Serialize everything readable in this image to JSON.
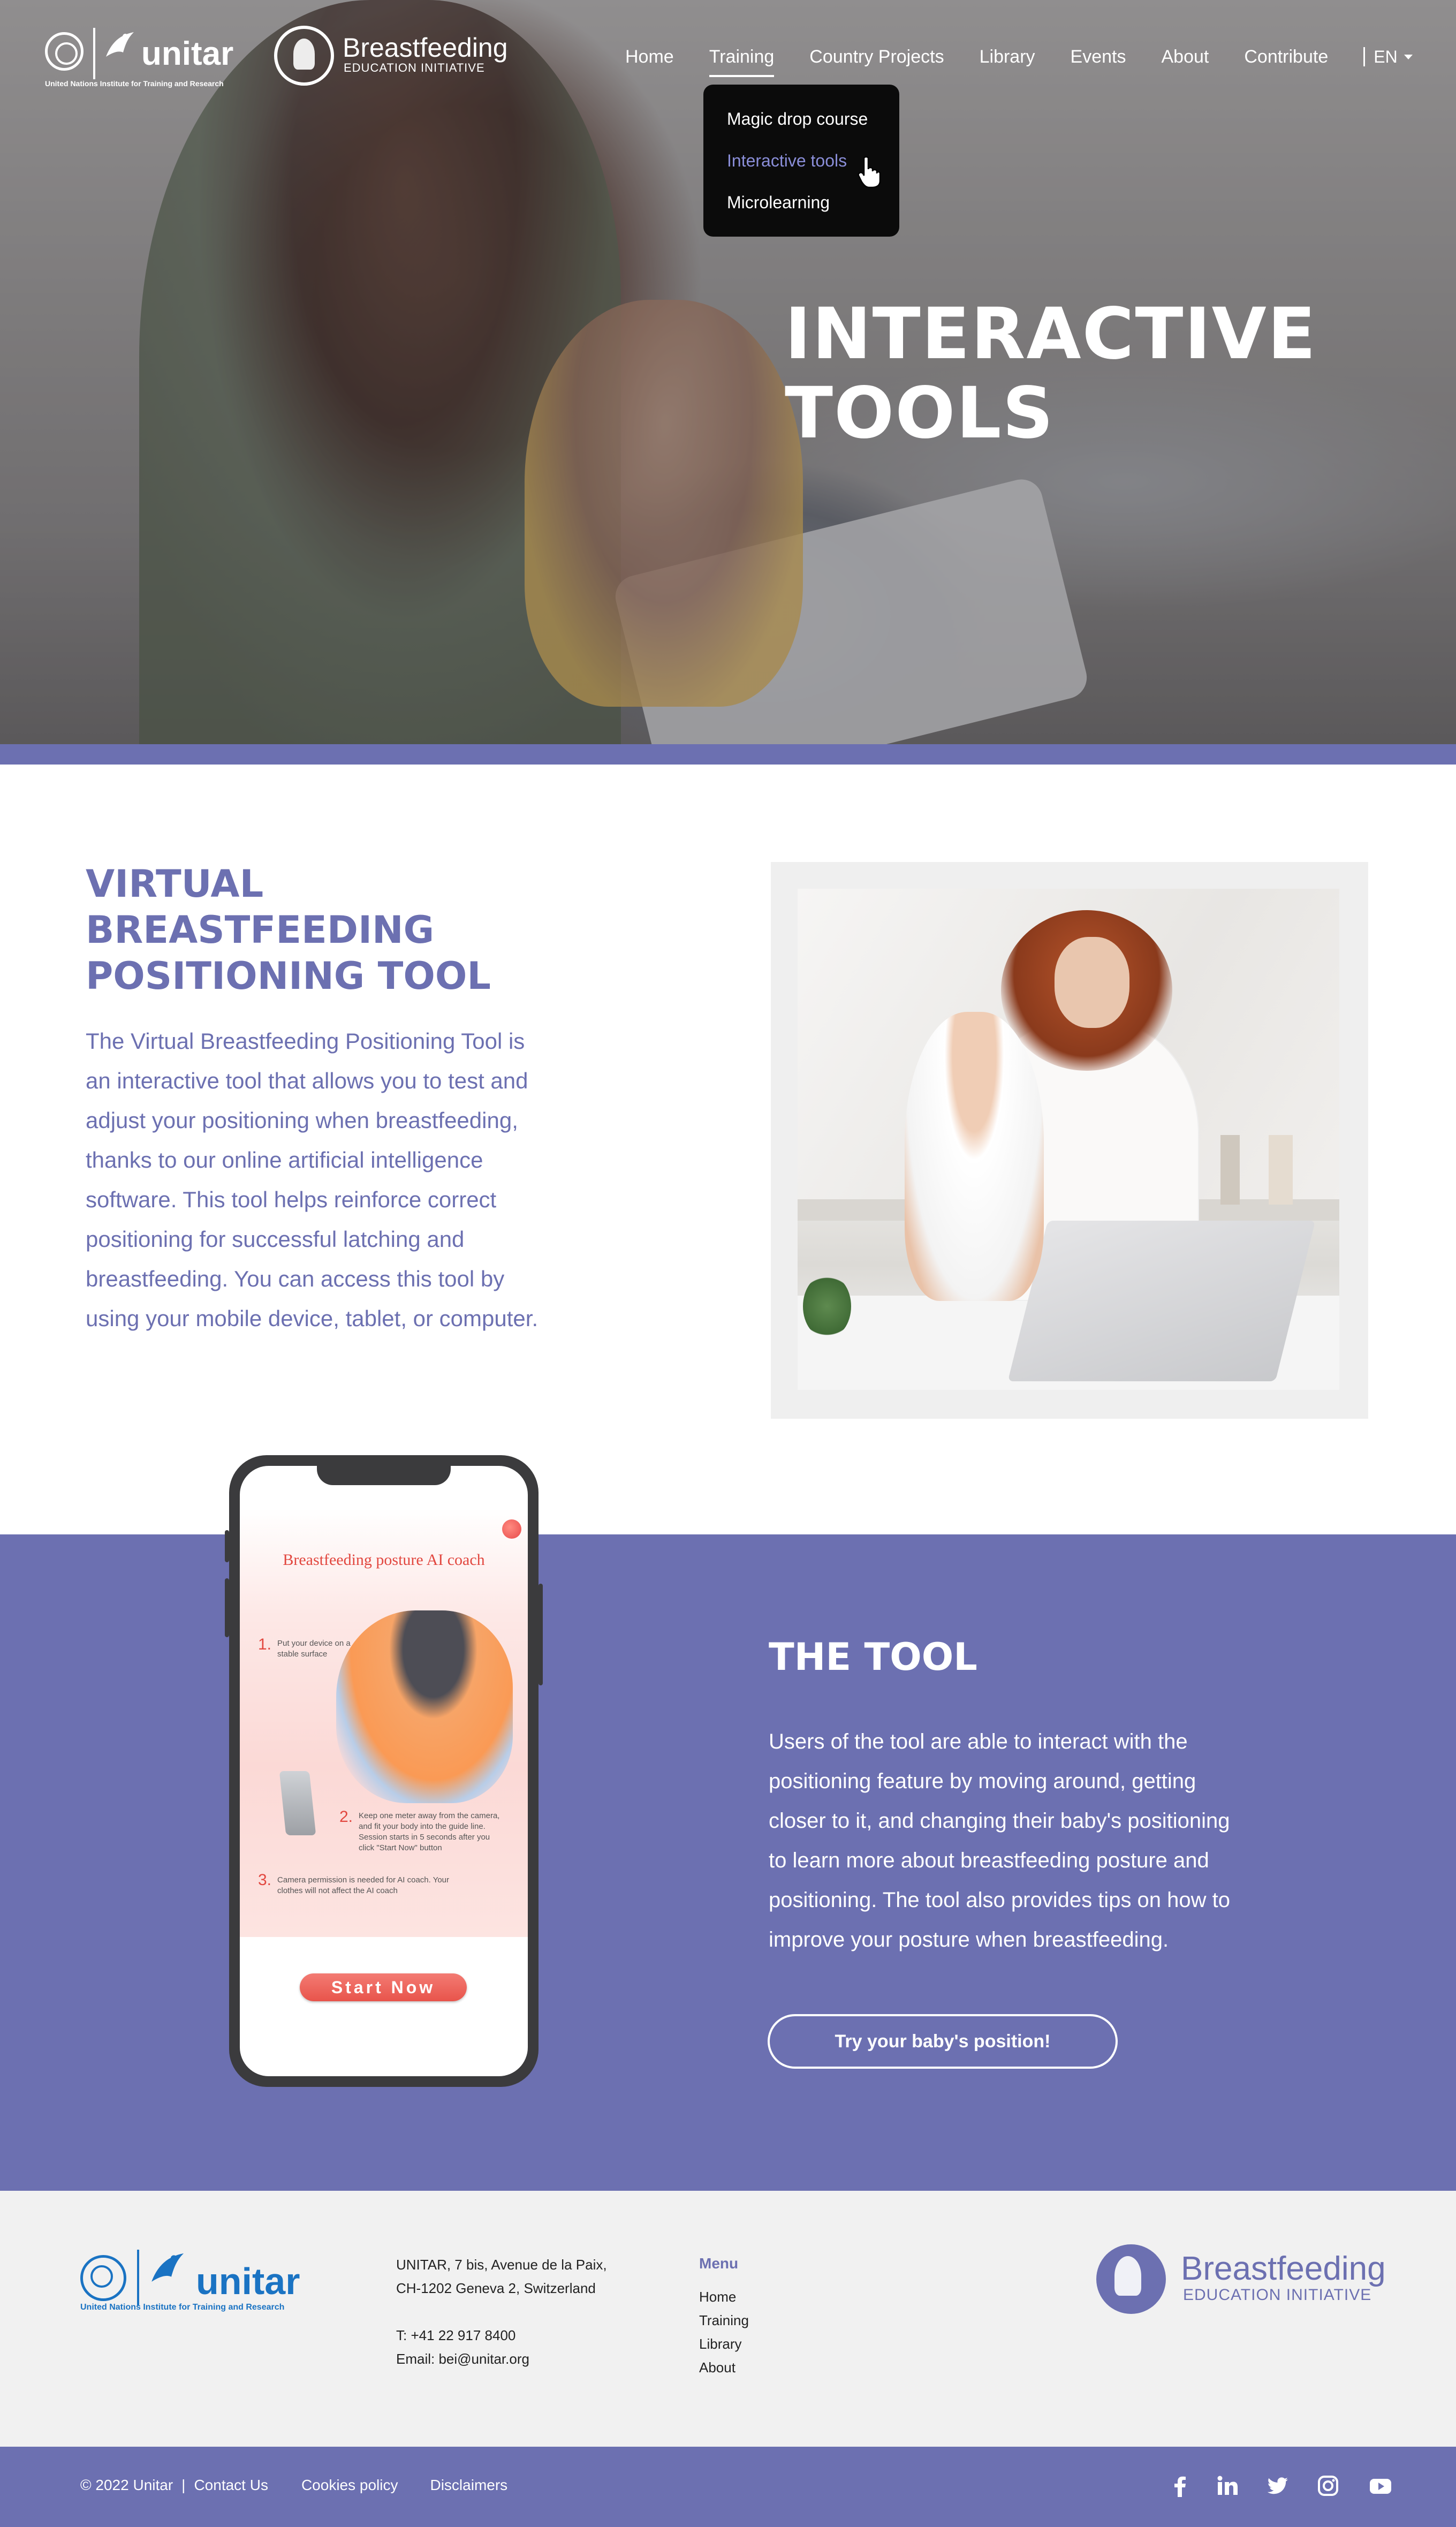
{
  "hero": {
    "title_line1": "INTERACTIVE",
    "title_line2": "TOOLS"
  },
  "logos": {
    "unitar_word": "unitar",
    "unitar_subtitle": "United Nations Institute for Training and Research",
    "bei_name": "Breastfeeding",
    "bei_tagline": "EDUCATION INITIATIVE"
  },
  "nav": {
    "items": [
      "Home",
      "Training",
      "Country Projects",
      "Library",
      "Events",
      "About",
      "Contribute"
    ],
    "active": "Training",
    "language": "EN"
  },
  "dropdown": {
    "items": [
      "Magic drop course",
      "Interactive tools",
      "Microlearning"
    ],
    "selected": "Interactive tools"
  },
  "section_vbpt": {
    "title_line1": "VIRTUAL",
    "title_line2": "BREASTFEEDING",
    "title_line3": "POSITIONING TOOL",
    "lines": [
      "The Virtual Breastfeeding Positioning Tool is",
      "an interactive tool that allows you to test and",
      "adjust your positioning when breastfeeding,",
      "thanks to our online artificial intelligence",
      "software. This tool helps reinforce correct",
      "positioning for successful latching and",
      "breastfeeding. You can access this tool by",
      "using your mobile device, tablet, or computer."
    ]
  },
  "phone_app": {
    "title": "Breastfeeding posture AI coach",
    "step1_num": "1.",
    "step1_text_l1": "Put your device on a",
    "step1_text_l2": "stable surface",
    "step2_num": "2.",
    "step2_text_l1": "Keep one meter away from the camera,",
    "step2_text_l2": "and fit your body into the guide line.",
    "step2_text_l3": "Session starts in 5 seconds after you",
    "step2_text_l4": "click \"Start Now\" button",
    "step3_num": "3.",
    "step3_text_l1": "Camera permission is needed for AI coach. Your",
    "step3_text_l2": "clothes will not affect the AI coach",
    "start_button": "Start Now"
  },
  "section_tool": {
    "title": "THE TOOL",
    "lines": [
      "Users of the tool are able to interact with the",
      "positioning feature by moving around, getting",
      "closer to it, and changing their baby's positioning",
      "to learn more about breastfeeding posture and",
      "positioning. The tool also provides tips on how to",
      "improve your posture when breastfeeding."
    ],
    "cta_label": "Try your baby's position!"
  },
  "footer": {
    "address_l1": "UNITAR, 7 bis, Avenue de la Paix,",
    "address_l2": "CH-1202 Geneva 2, Switzerland",
    "phone": "T: +41 22 917 8400",
    "email": "Email: bei@unitar.org",
    "menu_title": "Menu",
    "menu_items": [
      "Home",
      "Training",
      "Library",
      "About"
    ],
    "bottom_links": {
      "copyright": "© 2022 Unitar",
      "separator": "|",
      "contact": "Contact Us",
      "cookies": "Cookies policy",
      "disclaimers": "Disclaimers"
    },
    "social_icons": [
      "facebook-icon",
      "linkedin-icon",
      "twitter-icon",
      "instagram-icon",
      "youtube-icon"
    ]
  },
  "colors": {
    "accent_purple": "#6c70b1",
    "dropdown_bg": "#0b0b0b",
    "dropdown_selected": "#8a8ed8",
    "app_red": "#e2473f"
  }
}
